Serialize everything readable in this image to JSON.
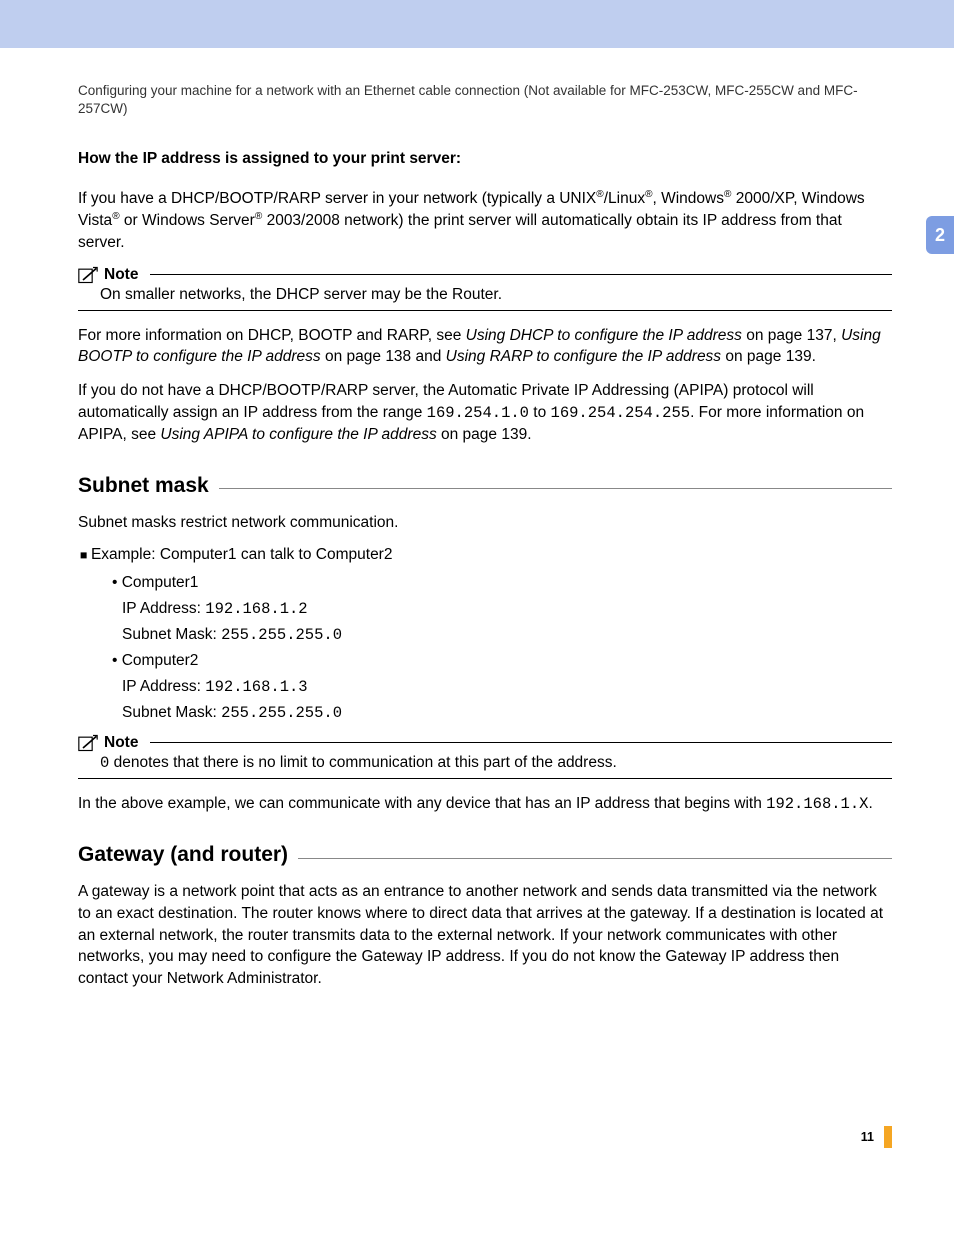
{
  "header": "Configuring your machine for a network with an Ethernet cable connection (Not available for MFC-253CW, MFC-255CW and MFC-257CW)",
  "sideTab": "2",
  "pageNumber": "11",
  "s1": {
    "lead": "How the IP address is assigned to your print server:",
    "p1a": "If you have a DHCP/BOOTP/RARP server in your network (typically a UNIX",
    "p1b": "/Linux",
    "p1c": ", Windows",
    "p1d": " 2000/XP, Windows Vista",
    "p1e": " or Windows Server",
    "p1f": " 2003/2008 network) the print server will automatically obtain its IP address from that server.",
    "noteLabel": "Note",
    "note1": "On smaller networks, the DHCP server may be the Router.",
    "p2a": "For more information on DHCP, BOOTP and RARP, see ",
    "p2b": "Using DHCP to configure the IP address",
    "p2c": " on page 137, ",
    "p2d": "Using BOOTP to configure the IP address",
    "p2e": " on page 138 and ",
    "p2f": "Using RARP to configure the IP address",
    "p2g": " on page 139.",
    "p3a": "If you do not have a DHCP/BOOTP/RARP server, the Automatic Private IP Addressing (APIPA) protocol will automatically assign an IP address from the range ",
    "p3b": "169.254.1.0",
    "p3c": " to ",
    "p3d": "169.254.254.255",
    "p3e": ". For more information on APIPA, see ",
    "p3f": "Using APIPA to configure the IP address",
    "p3g": " on page 139."
  },
  "s2": {
    "title": "Subnet mask",
    "p1": "Subnet masks restrict network communication.",
    "example": "Example: Computer1 can talk to Computer2",
    "c1name": "Computer1",
    "c1ipLabel": "IP Address: ",
    "c1ip": "192.168.1.2",
    "c1maskLabel": "Subnet Mask: ",
    "c1mask": "255.255.255.0",
    "c2name": "Computer2",
    "c2ipLabel": "IP Address: ",
    "c2ip": "192.168.1.3",
    "c2maskLabel": "Subnet Mask: ",
    "c2mask": "255.255.255.0",
    "noteLabel": "Note",
    "note2a": "0",
    "note2b": " denotes that there is no limit to communication at this part of the address.",
    "p4a": "In the above example, we can communicate with any device that has an IP address that begins with ",
    "p4b": "192.168.1.X",
    "p4c": "."
  },
  "s3": {
    "title": "Gateway (and router)",
    "p1": "A gateway is a network point that acts as an entrance to another network and sends data transmitted via the network to an exact destination. The router knows where to direct data that arrives at the gateway. If a destination is located at an external network, the router transmits data to the external network. If your network communicates with other networks, you may need to configure the Gateway IP address. If you do not know the Gateway IP address then contact your Network Administrator."
  }
}
